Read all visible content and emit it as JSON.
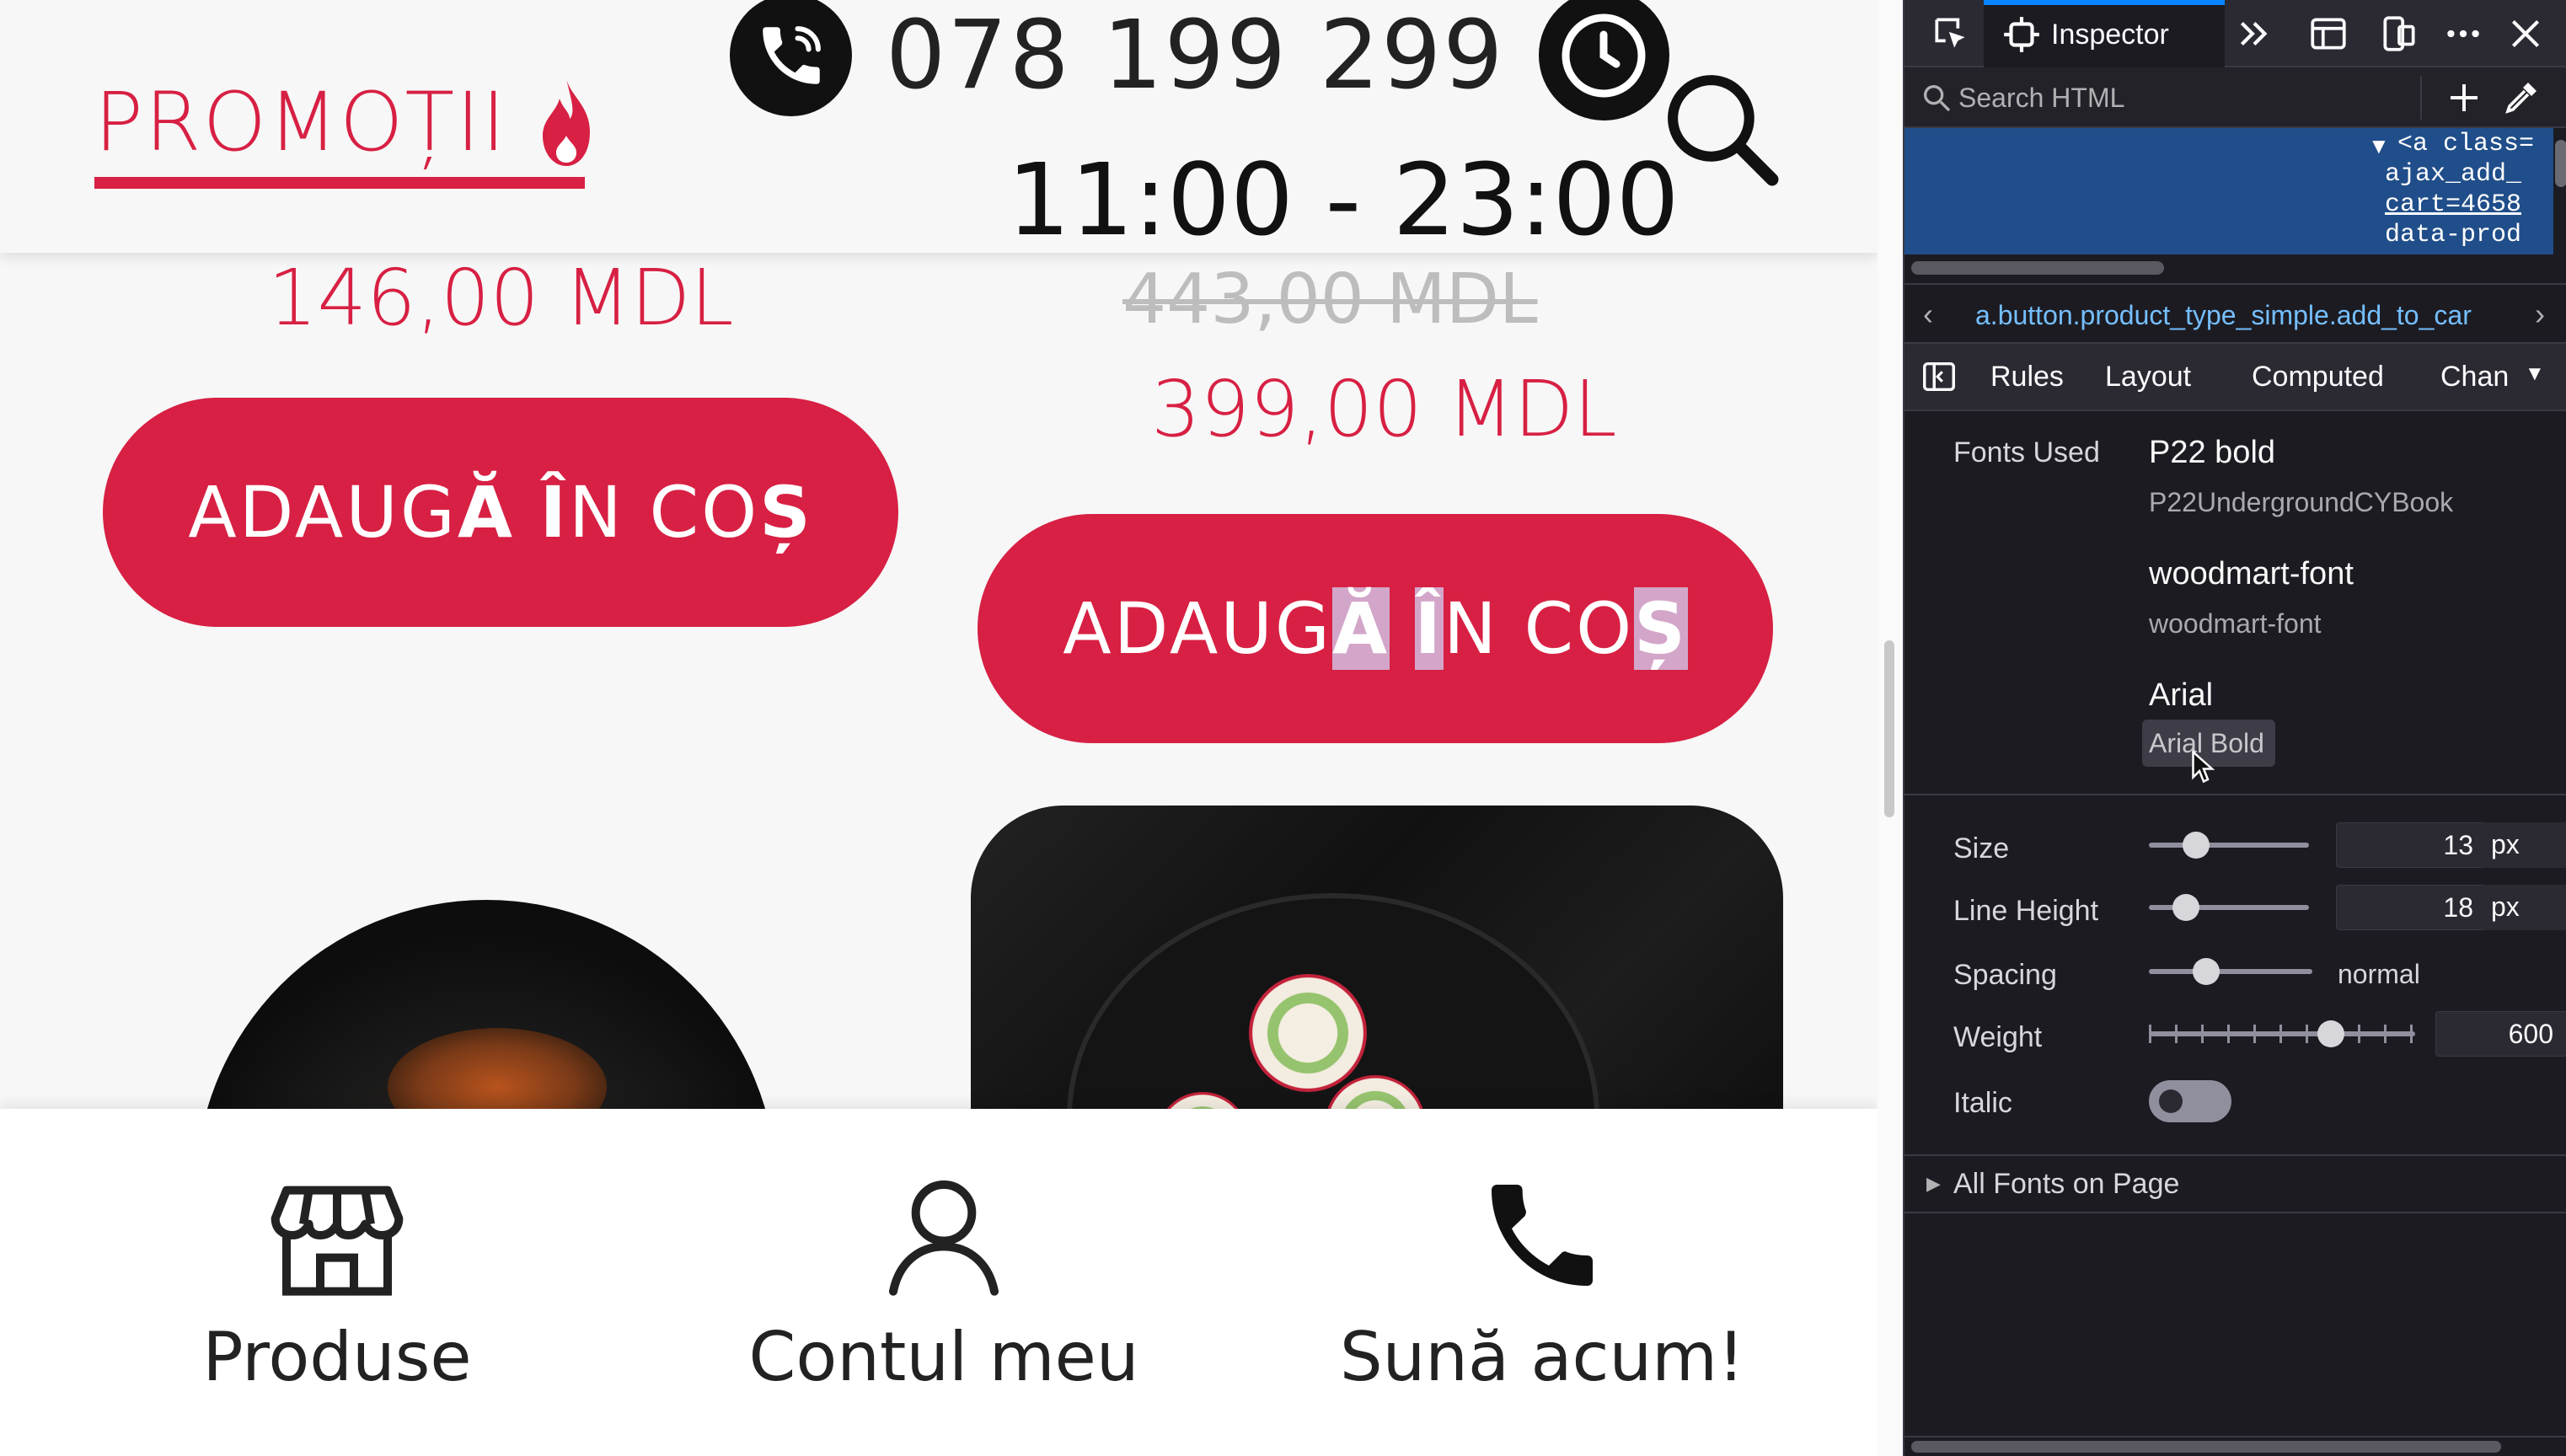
{
  "site": {
    "header": {
      "promo_label": "PROMOȚII",
      "phone_number": "078 199 299",
      "hours": "11:00 - 23:00"
    },
    "products": [
      {
        "price": "146,00 MDL",
        "button_prefix": "ADAUG",
        "button_a": "Ă",
        "button_space1": " ",
        "button_i": "Î",
        "button_mid": "N CO",
        "button_s": "Ș"
      },
      {
        "old_price": "443,00 MDL",
        "price": "399,00 MDL",
        "button_prefix": "ADAUG",
        "button_a": "Ă",
        "button_space1": " ",
        "button_i": "Î",
        "button_mid": "N CO",
        "button_s": "Ș"
      }
    ],
    "bottom_nav": [
      {
        "label": "Produse",
        "icon": "store-icon"
      },
      {
        "label": "Contul meu",
        "icon": "user-icon"
      },
      {
        "label": "Sună acum!",
        "icon": "phone-icon"
      }
    ],
    "colors": {
      "accent": "#d72043",
      "text": "#222222"
    }
  },
  "devtools": {
    "toolbar": {
      "active_tab": "Inspector"
    },
    "search": {
      "placeholder": "Search HTML"
    },
    "markup": {
      "lines": [
        "<a class=",
        "ajax_add_",
        "cart=4658",
        "data-prod"
      ]
    },
    "breadcrumb": "a.button.product_type_simple.add_to_car",
    "side_tabs": [
      "Rules",
      "Layout",
      "Computed",
      "Chan"
    ],
    "fonts": {
      "section_label": "Fonts Used",
      "entries": [
        {
          "name": "P22 bold",
          "sub": "P22UndergroundCYBook"
        },
        {
          "name": "woodmart-font",
          "sub": "woodmart-font"
        },
        {
          "name": "Arial",
          "sub": "Arial Bold"
        }
      ],
      "size_label": "Size",
      "size_value": "13",
      "size_unit": "px",
      "line_height_label": "Line Height",
      "line_height_value": "18",
      "line_height_unit": "px",
      "spacing_label": "Spacing",
      "spacing_value": "normal",
      "weight_label": "Weight",
      "weight_value": "600",
      "italic_label": "Italic",
      "italic_on": false,
      "all_fonts_label": "All Fonts on Page"
    }
  }
}
